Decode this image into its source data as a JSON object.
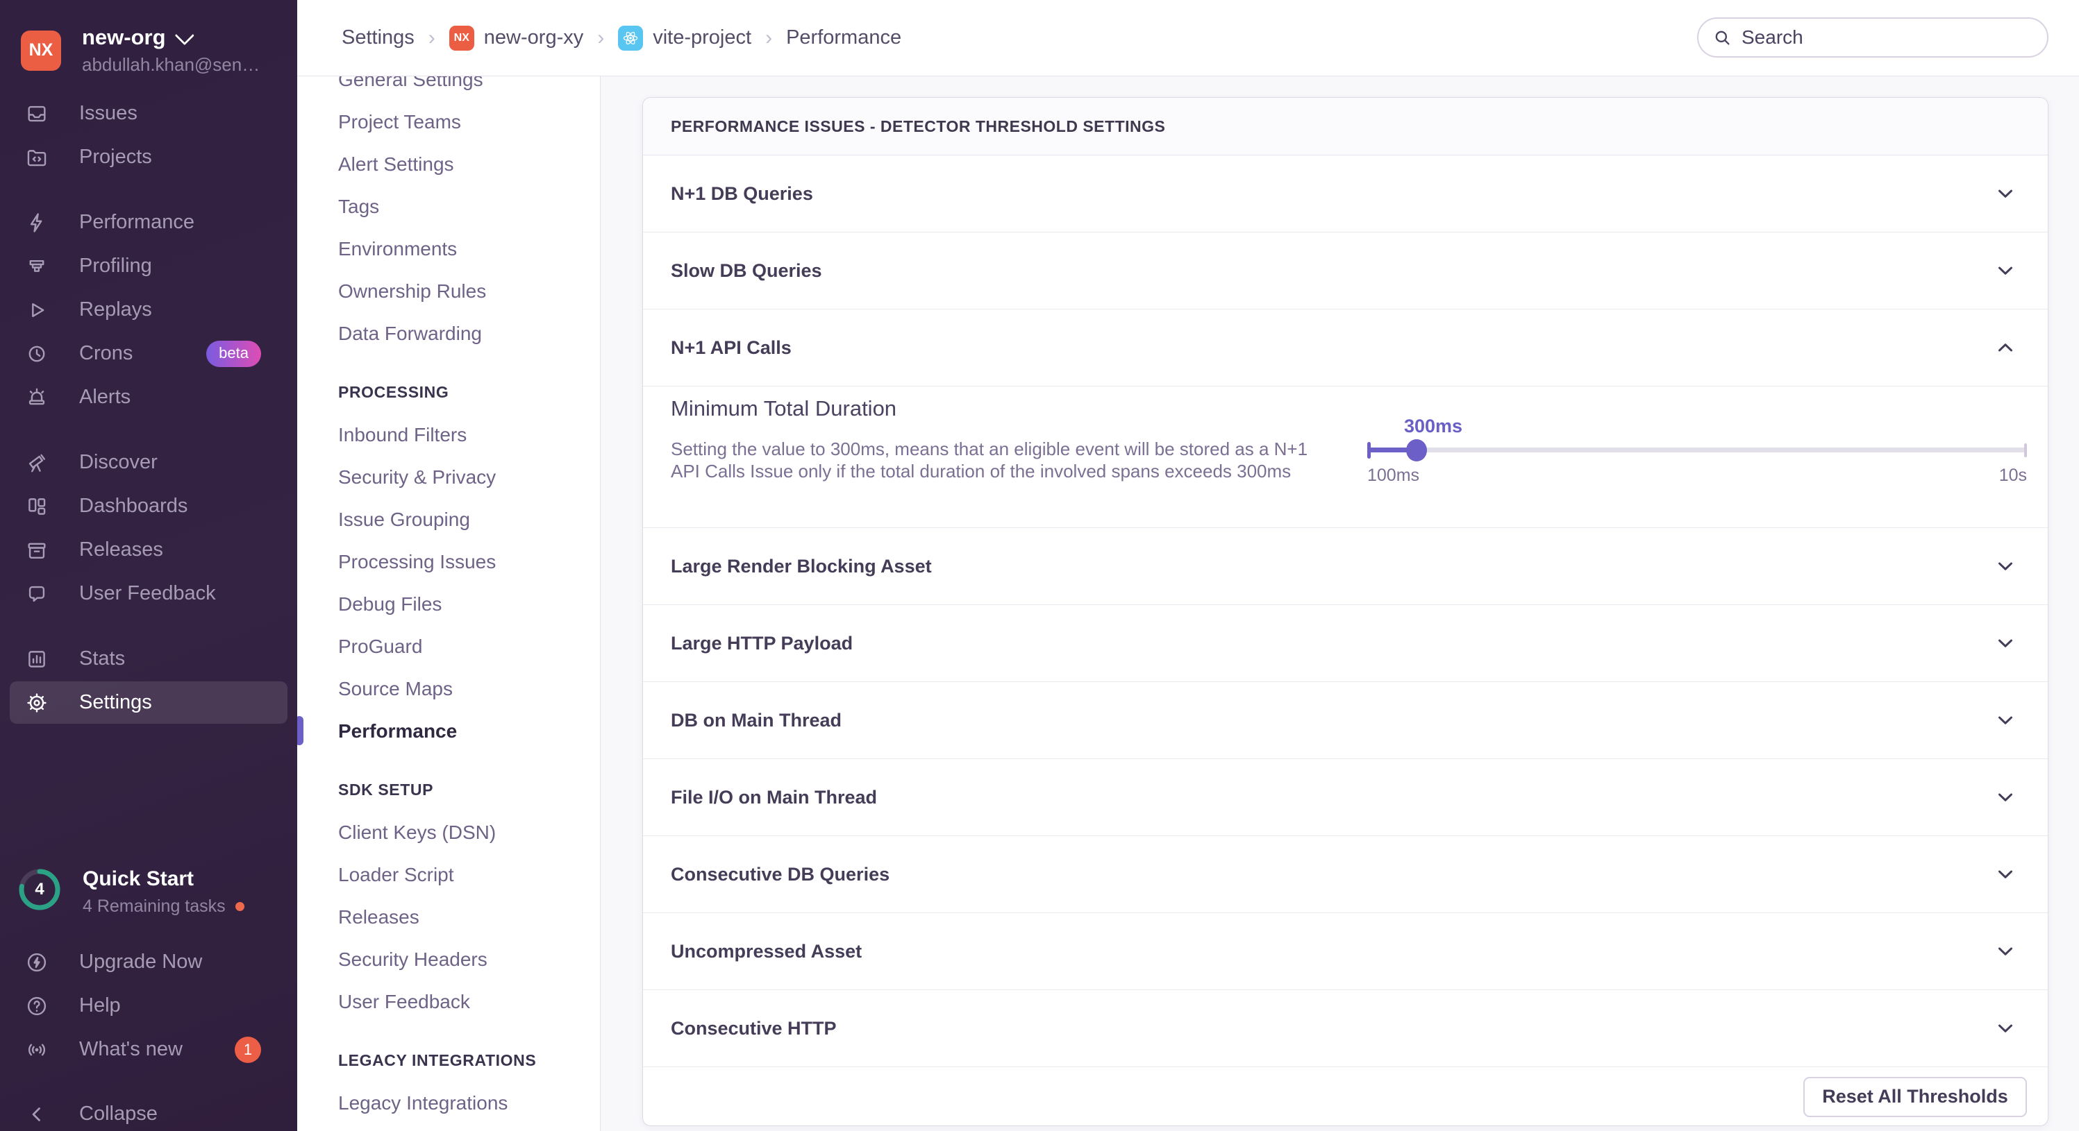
{
  "sidebar": {
    "org": {
      "initials": "NX",
      "name": "new-org",
      "email": "abdullah.khan@sen…"
    },
    "groups": [
      {
        "items": [
          {
            "label": "Issues"
          },
          {
            "label": "Projects"
          }
        ]
      },
      {
        "items": [
          {
            "label": "Performance"
          },
          {
            "label": "Profiling"
          },
          {
            "label": "Replays"
          },
          {
            "label": "Crons",
            "badge": "beta"
          },
          {
            "label": "Alerts"
          }
        ]
      },
      {
        "items": [
          {
            "label": "Discover"
          },
          {
            "label": "Dashboards"
          },
          {
            "label": "Releases"
          },
          {
            "label": "User Feedback"
          }
        ]
      },
      {
        "items": [
          {
            "label": "Stats"
          },
          {
            "label": "Settings",
            "active": true
          }
        ]
      }
    ],
    "quick_start": {
      "title": "Quick Start",
      "subtitle": "4 Remaining tasks",
      "count": "4"
    },
    "footer": [
      {
        "label": "Upgrade Now"
      },
      {
        "label": "Help"
      },
      {
        "label": "What's new",
        "badge": "1"
      },
      {
        "label": "Collapse"
      }
    ]
  },
  "topbar": {
    "breadcrumbs": [
      {
        "label": "Settings"
      },
      {
        "label": "new-org-xy",
        "icon": "nx"
      },
      {
        "label": "vite-project",
        "icon": "react"
      },
      {
        "label": "Performance"
      }
    ],
    "search_placeholder": "Search"
  },
  "settings_nav": {
    "sections": [
      {
        "title": "",
        "items": [
          "General Settings",
          "Project Teams",
          "Alert Settings",
          "Tags",
          "Environments",
          "Ownership Rules",
          "Data Forwarding"
        ]
      },
      {
        "title": "PROCESSING",
        "items": [
          "Inbound Filters",
          "Security & Privacy",
          "Issue Grouping",
          "Processing Issues",
          "Debug Files",
          "ProGuard",
          "Source Maps",
          "Performance"
        ]
      },
      {
        "title": "SDK SETUP",
        "items": [
          "Client Keys (DSN)",
          "Loader Script",
          "Releases",
          "Security Headers",
          "User Feedback"
        ]
      },
      {
        "title": "LEGACY INTEGRATIONS",
        "items": [
          "Legacy Integrations"
        ]
      }
    ],
    "active_item": "Performance"
  },
  "panel": {
    "title": "PERFORMANCE ISSUES - DETECTOR THRESHOLD SETTINGS",
    "rows": [
      "N+1 DB Queries",
      "Slow DB Queries",
      "N+1 API Calls",
      "Large Render Blocking Asset",
      "Large HTTP Payload",
      "DB on Main Thread",
      "File I/O on Main Thread",
      "Consecutive DB Queries",
      "Uncompressed Asset",
      "Consecutive HTTP"
    ],
    "expanded_row": "N+1 API Calls",
    "detail": {
      "setting_label": "Minimum Total Duration",
      "setting_description": "Setting the value to 300ms, means that an eligible event will be stored as a N+1 API Calls Issue only if the total duration of the involved spans exceeds 300ms",
      "slider": {
        "value_label": "300ms",
        "min_label": "100ms",
        "max_label": "10s",
        "percent": 7.5
      }
    },
    "reset_button_label": "Reset All Thresholds"
  },
  "colors": {
    "accent_purple": "#6C5FC7",
    "sidebar_bg": "#332041",
    "avatar_orange": "#ec5e44",
    "badge_red": "#ec5e45",
    "beta_gradient_start": "#7a5be0",
    "beta_gradient_end": "#de4db4",
    "quickstart_teal": "#2ba185",
    "react_cyan": "#58c6f0"
  }
}
